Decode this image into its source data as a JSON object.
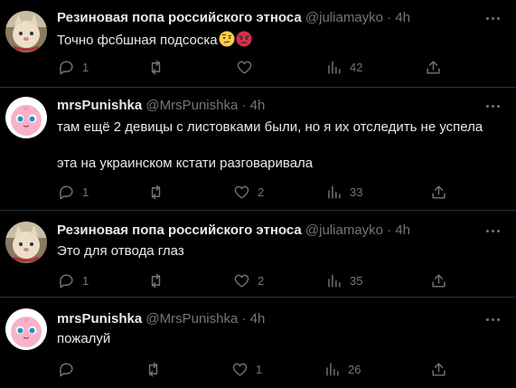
{
  "tweets": [
    {
      "name": "Резиновая попа российского этноса",
      "handle": "@juliamayko",
      "sep": "·",
      "time": "4h",
      "lines": [
        "Точно фсбшная подсоска"
      ],
      "emojis": [
        "face-with-raised-eyebrow",
        "angry-face"
      ],
      "replies": "1",
      "retweets": "",
      "likes": "",
      "views": "42",
      "avatar": "cat-avatar"
    },
    {
      "name": "mrsPunishka",
      "handle": "@MrsPunishka",
      "sep": "·",
      "time": "4h",
      "lines": [
        "там ещё 2 девицы с листовками были, но я их отследить не успела",
        "эта на украинском кстати разговаривала"
      ],
      "replies": "1",
      "retweets": "",
      "likes": "2",
      "views": "33",
      "avatar": "pink-puff-avatar"
    },
    {
      "name": "Резиновая попа российского этноса",
      "handle": "@juliamayko",
      "sep": "·",
      "time": "4h",
      "lines": [
        "Это для отвода глаз"
      ],
      "replies": "1",
      "retweets": "",
      "likes": "2",
      "views": "35",
      "avatar": "cat-avatar"
    },
    {
      "name": "mrsPunishka",
      "handle": "@MrsPunishka",
      "sep": "·",
      "time": "4h",
      "lines": [
        "пожалуй"
      ],
      "replies": "",
      "retweets": "",
      "likes": "1",
      "views": "26",
      "avatar": "pink-puff-avatar"
    }
  ],
  "colors": {
    "background": "#000000",
    "text": "#e7e9ea",
    "muted": "#71767b",
    "divider": "#2f3336"
  }
}
